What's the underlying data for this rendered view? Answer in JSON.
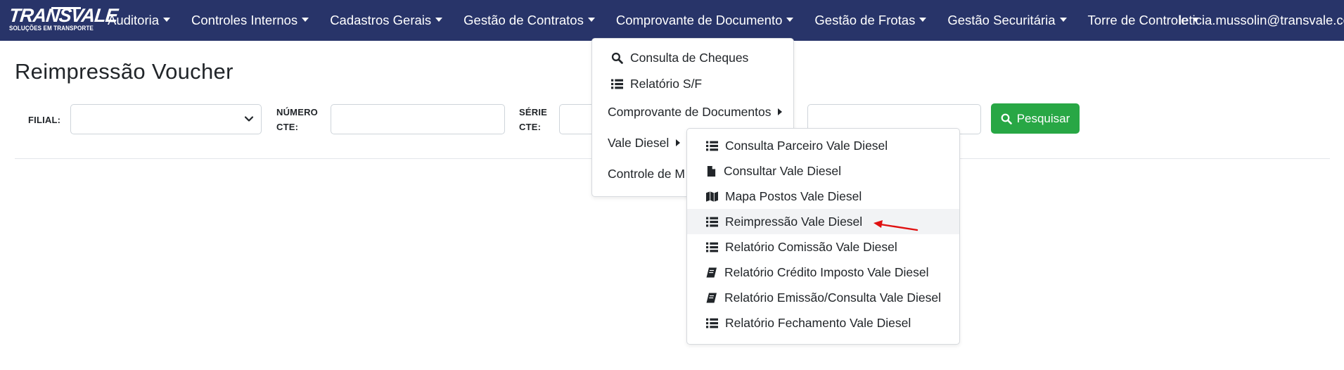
{
  "navbar": {
    "logo_text": "TRANSVALE",
    "logo_tagline": "SOLUÇÕES EM TRANSPORTE",
    "items": [
      {
        "label": "Auditoria"
      },
      {
        "label": "Controles Internos"
      },
      {
        "label": "Cadastros Gerais"
      },
      {
        "label": "Gestão de Contratos"
      },
      {
        "label": "Comprovante de Documento"
      },
      {
        "label": "Gestão de Frotas"
      },
      {
        "label": "Gestão Securitária"
      },
      {
        "label": "Torre de Controle"
      }
    ],
    "user_email": "leticia.mussolin@transvale.com"
  },
  "page": {
    "title": "Reimpressão Voucher"
  },
  "filters": {
    "filial_label": "FILIAL:",
    "filial_value": "",
    "numero_cte_line1": "NÚMERO",
    "numero_cte_line2": "CTE:",
    "numero_cte_value": "",
    "serie_cte_line1": "SÉRIE",
    "serie_cte_line2": "CTE:",
    "serie_cte_value": "",
    "extra_value": "",
    "search_label": "Pesquisar"
  },
  "dropdown_main": {
    "items": [
      {
        "label": "Consulta de Cheques",
        "icon": "search-icon"
      },
      {
        "label": "Relatório S/F",
        "icon": "list-icon"
      },
      {
        "label": "Comprovante de Documentos",
        "icon": "submenu-arrow"
      },
      {
        "label": "Vale Diesel",
        "icon": "submenu-arrow"
      },
      {
        "label": "Controle de M",
        "icon": ""
      }
    ]
  },
  "dropdown_vale_diesel": {
    "active_index": 3,
    "items": [
      {
        "label": "Consulta Parceiro Vale Diesel",
        "icon": "list-icon"
      },
      {
        "label": "Consultar Vale Diesel",
        "icon": "file-icon"
      },
      {
        "label": "Mapa Postos Vale Diesel",
        "icon": "map-icon"
      },
      {
        "label": "Reimpressão Vale Diesel",
        "icon": "list-icon"
      },
      {
        "label": "Relatório Comissão Vale Diesel",
        "icon": "list-icon"
      },
      {
        "label": "Relatório Crédito Imposto Vale Diesel",
        "icon": "book-icon"
      },
      {
        "label": "Relatório Emissão/Consulta Vale Diesel",
        "icon": "book-icon"
      },
      {
        "label": "Relatório Fechamento Vale Diesel",
        "icon": "list-icon"
      }
    ]
  },
  "colors": {
    "navbar_bg": "#283469",
    "search_button": "#28a745",
    "annotation_arrow": "#e01010"
  }
}
